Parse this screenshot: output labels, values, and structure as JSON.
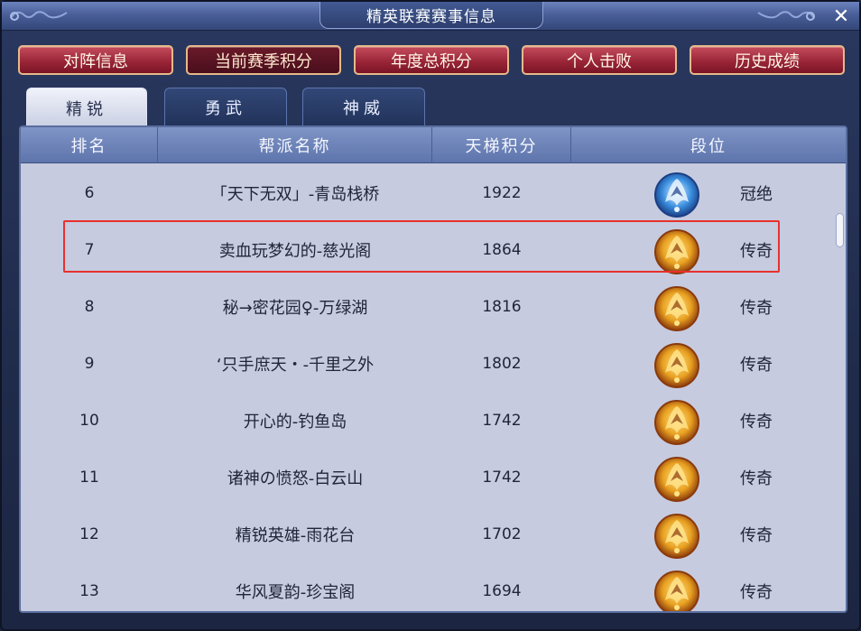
{
  "window": {
    "title": "精英联赛赛事信息",
    "close_glyph": "✕"
  },
  "top_buttons": [
    {
      "label": "对阵信息",
      "active": false
    },
    {
      "label": "当前赛季积分",
      "active": true
    },
    {
      "label": "年度总积分",
      "active": false
    },
    {
      "label": "个人击败",
      "active": false
    },
    {
      "label": "历史成绩",
      "active": false
    }
  ],
  "sub_tabs": [
    {
      "label": "精锐",
      "active": true
    },
    {
      "label": "勇武",
      "active": false
    },
    {
      "label": "神威",
      "active": false
    }
  ],
  "table": {
    "headers": [
      "排名",
      "帮派名称",
      "天梯积分",
      "段位"
    ],
    "rows": [
      {
        "rank": "6",
        "name": "「天下无双」-青岛栈桥",
        "score": "1922",
        "tier": "冠绝",
        "tier_icon": "champion-crest-icon"
      },
      {
        "rank": "7",
        "name": "卖血玩梦幻的-慈光阁",
        "score": "1864",
        "tier": "传奇",
        "tier_icon": "legend-crest-icon"
      },
      {
        "rank": "8",
        "name": "秘→密花园♀-万绿湖",
        "score": "1816",
        "tier": "传奇",
        "tier_icon": "legend-crest-icon"
      },
      {
        "rank": "9",
        "name": "‘只手庶天・-千里之外",
        "score": "1802",
        "tier": "传奇",
        "tier_icon": "legend-crest-icon"
      },
      {
        "rank": "10",
        "name": "开心的-钓鱼岛",
        "score": "1742",
        "tier": "传奇",
        "tier_icon": "legend-crest-icon"
      },
      {
        "rank": "11",
        "name": "诸神の愤怒-白云山",
        "score": "1742",
        "tier": "传奇",
        "tier_icon": "legend-crest-icon"
      },
      {
        "rank": "12",
        "name": "精锐英雄-雨花台",
        "score": "1702",
        "tier": "传奇",
        "tier_icon": "legend-crest-icon"
      },
      {
        "rank": "13",
        "name": "华风夏韵-珍宝阁",
        "score": "1694",
        "tier": "传奇",
        "tier_icon": "legend-crest-icon"
      }
    ],
    "highlighted_rank": "7"
  },
  "colors": {
    "highlight_border": "#e8302c",
    "button_red": "#9a2638",
    "champion_blue": "#3a8fe0",
    "legend_gold": "#e8a020"
  },
  "scroll": {
    "position_fraction": 0.1
  }
}
